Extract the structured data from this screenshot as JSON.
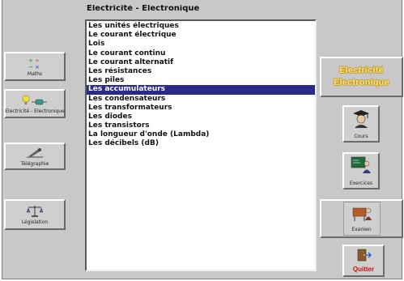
{
  "list": {
    "title": "Electricité - Electronique",
    "items": [
      "Les unités électriques",
      "Le courant électrique",
      "Lois",
      "Le courant continu",
      "Le courant alternatif",
      "Les résistances",
      "Les piles",
      "Les accumulateurs",
      "Les condensateurs",
      "Les transformateurs",
      "Les diodes",
      "Les transistors",
      "La longueur d'onde (Lambda)",
      "Les décibels (dB)"
    ],
    "selected_index": 7
  },
  "left_nav": {
    "maths": "Maths",
    "electricite": "Electricité - Electronique",
    "telegraphie": "Télégraphie",
    "legislation": "Législation"
  },
  "right_panel": {
    "title_line1": "Electricité",
    "title_line2": "Electronique",
    "cours": "Cours",
    "exercices": "Exercices",
    "examen": "Examen",
    "quitter": "Quitter"
  },
  "colors": {
    "selection": "#2a2a8c",
    "title_text": "#f2e2a0",
    "quit_text": "#cc1010"
  }
}
